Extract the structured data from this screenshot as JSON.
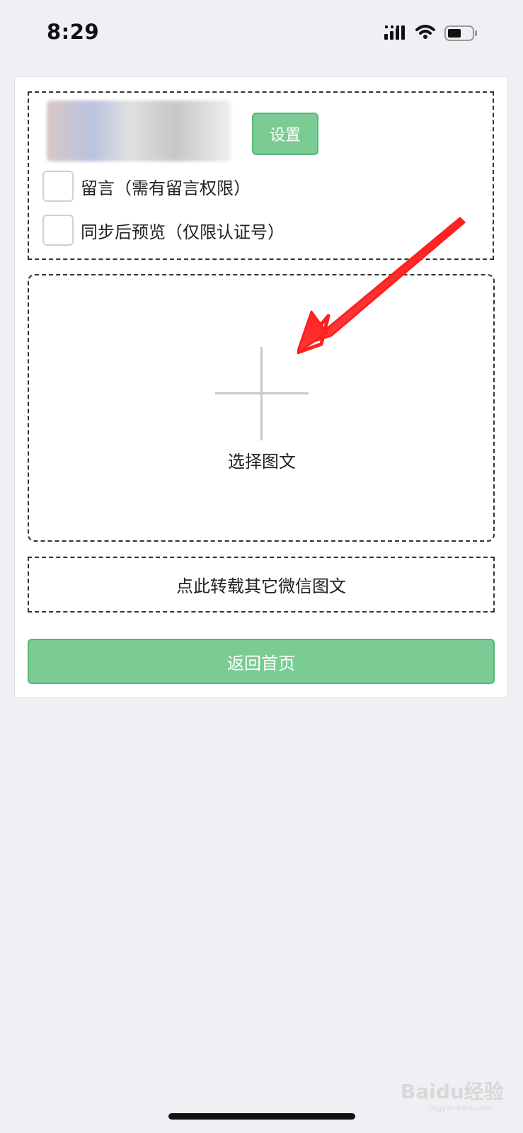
{
  "status_bar": {
    "time": "8:29"
  },
  "post_settings": {
    "set_button_label": "设置",
    "options": [
      {
        "label": "留言（需有留言权限）",
        "checked": false
      },
      {
        "label": "同步后预览（仅限认证号）",
        "checked": false
      }
    ]
  },
  "content_picker": {
    "label": "选择图文"
  },
  "repost": {
    "label": "点此转载其它微信图文"
  },
  "navigation": {
    "home_button_label": "返回首页"
  },
  "watermark": {
    "text": "Baidu经验",
    "subtext": "jingyan.baidu.com"
  },
  "icons": {
    "signal": "cellular-signal-icon",
    "wifi": "wifi-icon",
    "battery": "battery-icon",
    "add": "plus-icon",
    "annotation": "red-arrow-icon"
  },
  "colors": {
    "background": "#efeff4",
    "accent_green": "#7bcb95",
    "annotation_red": "#ff2a2a"
  }
}
